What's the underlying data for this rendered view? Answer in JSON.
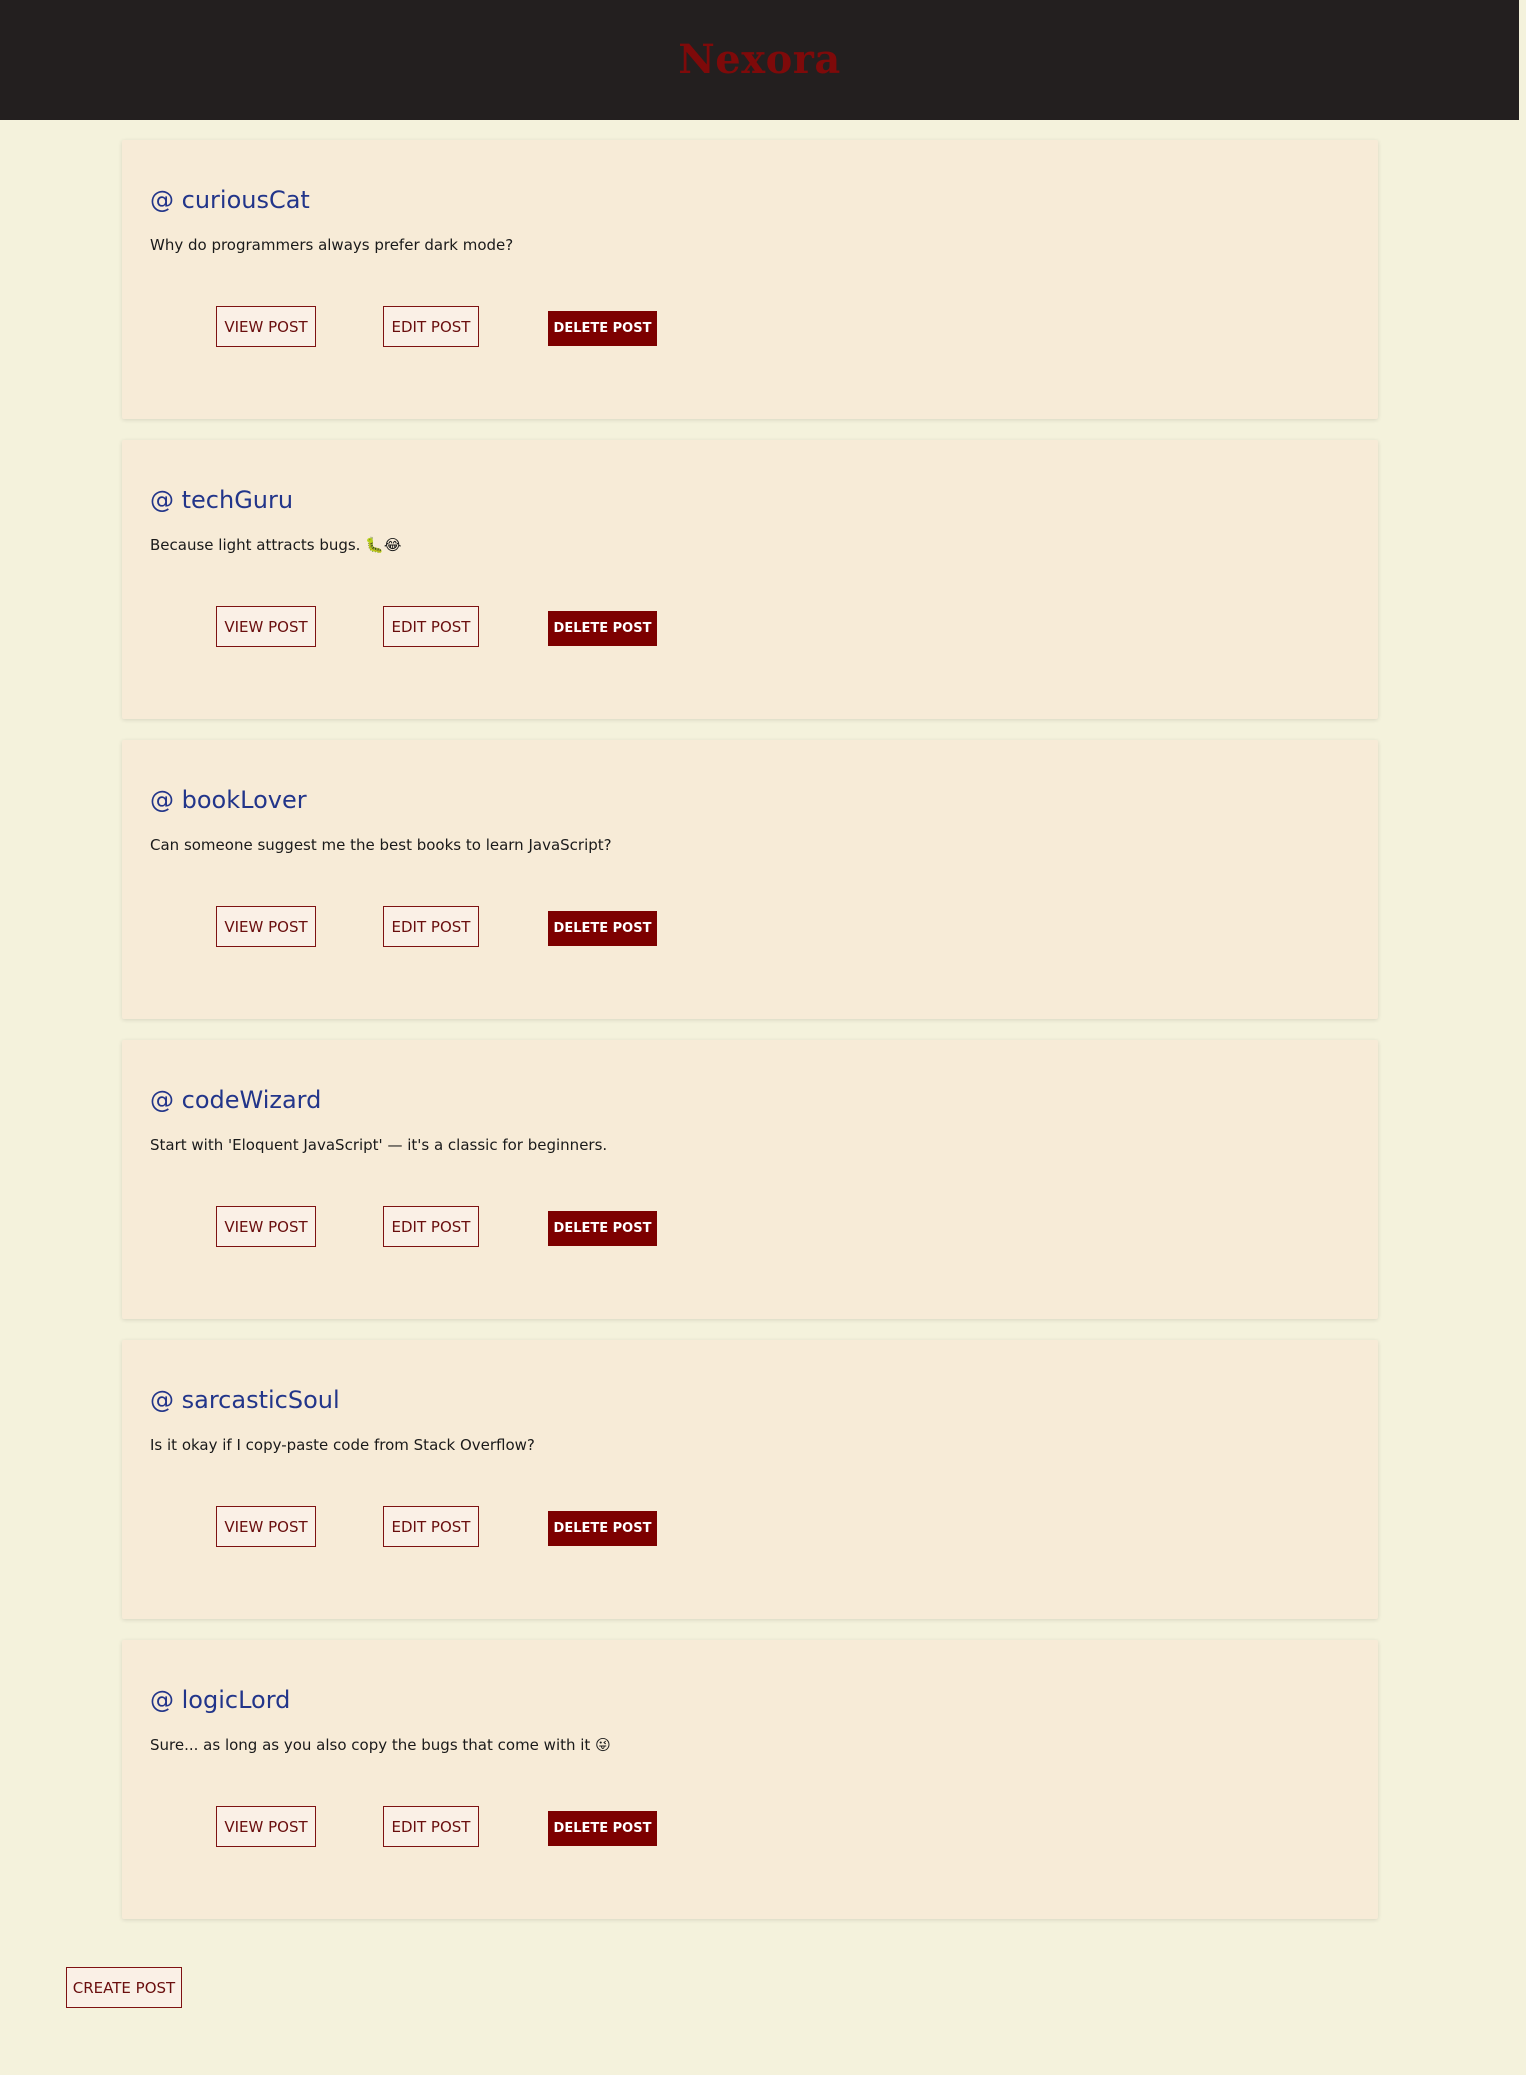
{
  "header": {
    "brand": "Nexora",
    "background_color": "#231f1f",
    "brand_color": "#7e0a0a"
  },
  "posts": [
    {
      "username": "@ curiousCat",
      "content": "Why do programmers always prefer dark mode?",
      "view_label": "VIEW POST",
      "edit_label": "EDIT POST",
      "delete_label": "DELETE POST"
    },
    {
      "username": "@ techGuru",
      "content": "Because light attracts bugs. 🐛😂",
      "view_label": "VIEW POST",
      "edit_label": "EDIT POST",
      "delete_label": "DELETE POST"
    },
    {
      "username": "@ bookLover",
      "content": "Can someone suggest me the best books to learn JavaScript?",
      "view_label": "VIEW POST",
      "edit_label": "EDIT POST",
      "delete_label": "DELETE POST"
    },
    {
      "username": "@ codeWizard",
      "content": "Start with 'Eloquent JavaScript' — it's a classic for beginners.",
      "view_label": "VIEW POST",
      "edit_label": "EDIT POST",
      "delete_label": "DELETE POST"
    },
    {
      "username": "@ sarcasticSoul",
      "content": "Is it okay if I copy-paste code from Stack Overflow?",
      "view_label": "VIEW POST",
      "edit_label": "EDIT POST",
      "delete_label": "DELETE POST"
    },
    {
      "username": "@ logicLord",
      "content": "Sure... as long as you also copy the bugs that come with it 😜",
      "view_label": "VIEW POST",
      "edit_label": "EDIT POST",
      "delete_label": "DELETE POST"
    }
  ],
  "footer": {
    "create_label": "CREATE POST"
  },
  "colors": {
    "page_background": "#f4f2dc",
    "card_background": "#f7ebd7",
    "username": "#22358a",
    "accent": "#7d0000"
  }
}
